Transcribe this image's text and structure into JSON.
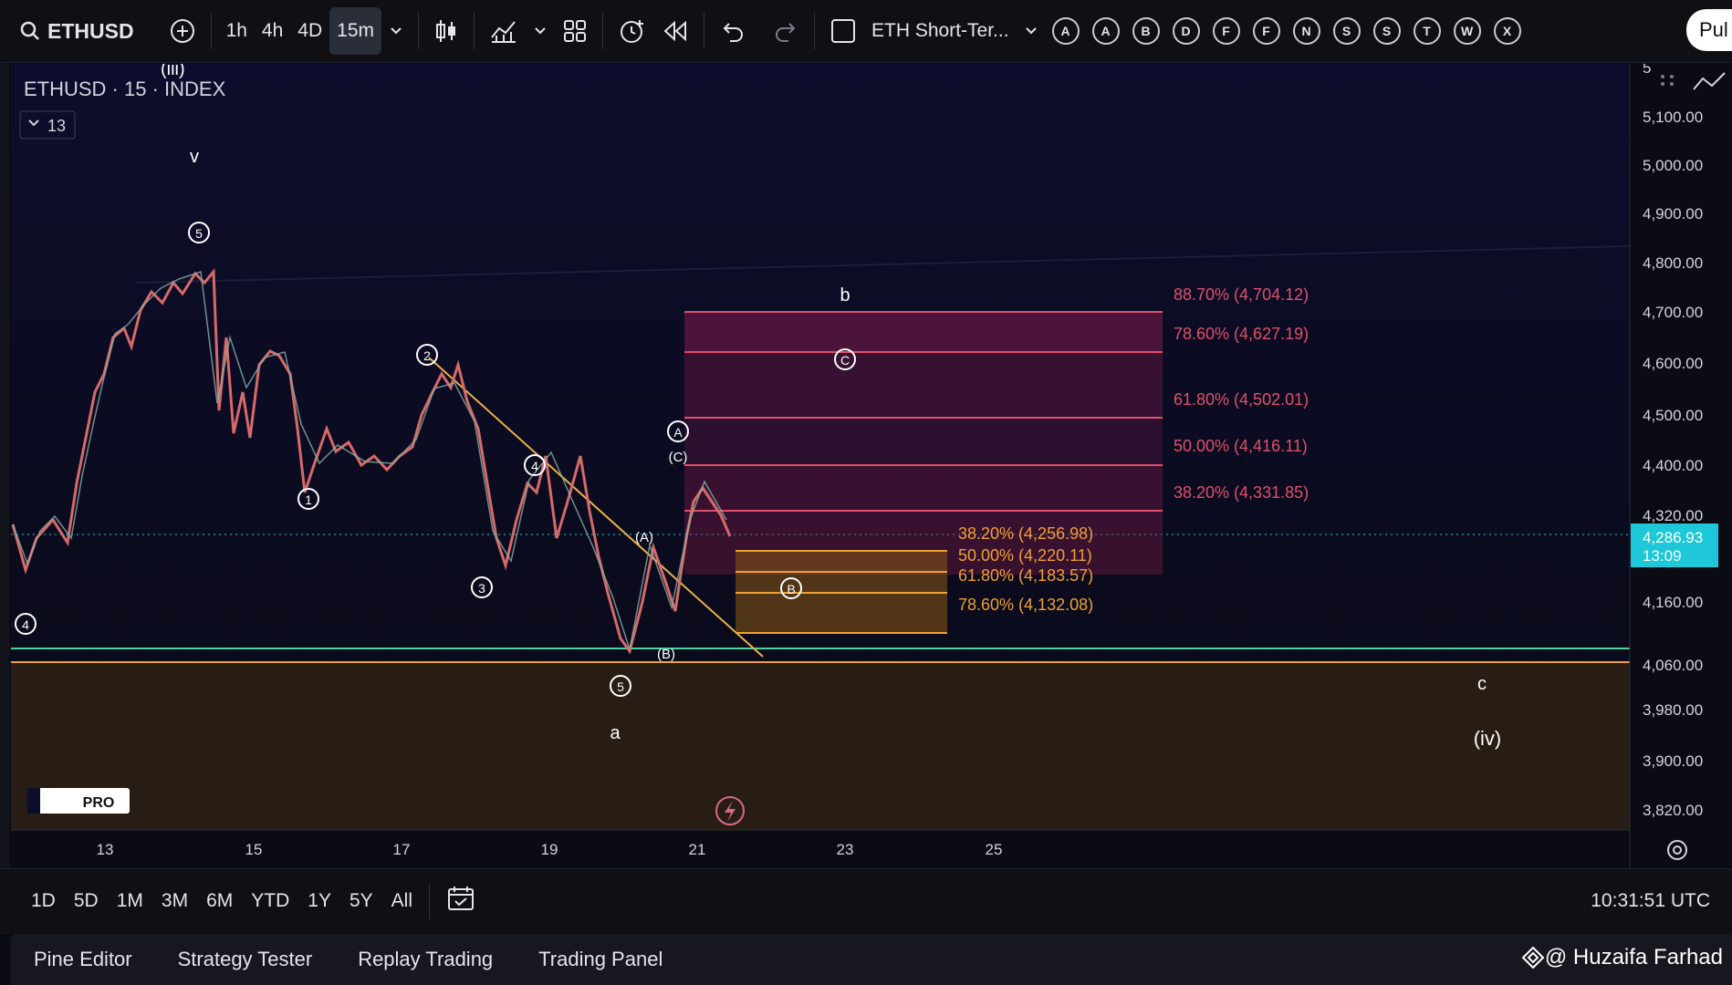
{
  "toolbar": {
    "symbol": "ETHUSD",
    "intervals": [
      "1h",
      "4h",
      "4D",
      "15m"
    ],
    "active_interval": "15m",
    "layout_name": "ETH Short-Ter...",
    "letter_buttons": [
      "A",
      "A",
      "B",
      "D",
      "F",
      "F",
      "N",
      "S",
      "S",
      "T",
      "W",
      "X"
    ],
    "publish_label": "Pul"
  },
  "legend": {
    "title": "ETHUSD · 15 · INDEX",
    "indicator_count": "13"
  },
  "price_axis": {
    "labels": [
      "5",
      "5,100.00",
      "5,000.00",
      "4,900.00",
      "4,800.00",
      "4,700.00",
      "4,600.00",
      "4,500.00",
      "4,400.00",
      "4,320.00",
      "4,160.00",
      "4,060.00",
      "3,980.00",
      "3,900.00",
      "3,820.00"
    ],
    "current_price": "4,286.93",
    "countdown": "13:09"
  },
  "time_axis": {
    "labels": [
      "13",
      "15",
      "17",
      "19",
      "21",
      "23",
      "25"
    ]
  },
  "fib_upper": [
    {
      "label": "88.70% (4,704.12)"
    },
    {
      "label": "78.60% (4,627.19)"
    },
    {
      "label": "61.80% (4,502.01)"
    },
    {
      "label": "50.00% (4,416.11)"
    },
    {
      "label": "38.20% (4,331.85)"
    }
  ],
  "fib_lower": [
    {
      "label": "38.20% (4,256.98)"
    },
    {
      "label": "50.00% (4,220.11)"
    },
    {
      "label": "61.80% (4,183.57)"
    },
    {
      "label": "78.60% (4,132.08)"
    }
  ],
  "wave_labels": {
    "iii": "(iii)",
    "v": "v",
    "five_top": "5",
    "one": "1",
    "two": "2",
    "three": "3",
    "four": "4",
    "five_bottom": "5",
    "four_left": "4",
    "a": "a",
    "b": "b",
    "c_circle": "C",
    "A_circle": "A",
    "C_paren": "(C)",
    "A_paren": "(A)",
    "B_paren": "(B)",
    "B_circle": "B",
    "c": "c",
    "iv": "(iv)"
  },
  "logo_text": "PRO",
  "timeframes": [
    "1D",
    "5D",
    "1M",
    "3M",
    "6M",
    "YTD",
    "1Y",
    "5Y",
    "All"
  ],
  "clock": "10:31:51 UTC",
  "bottom_panel": [
    "Pine Editor",
    "Strategy Tester",
    "Replay Trading",
    "Trading Panel"
  ],
  "watermark": "@ Huzaifa Farhad",
  "colors": {
    "upper_fib": "#e0506a",
    "lower_fib": "#f0a030",
    "trendline": "#e8b04a",
    "support_green": "#4cd3a0",
    "support_orange": "#f0a030",
    "price_tag": "#1ec8d8"
  }
}
